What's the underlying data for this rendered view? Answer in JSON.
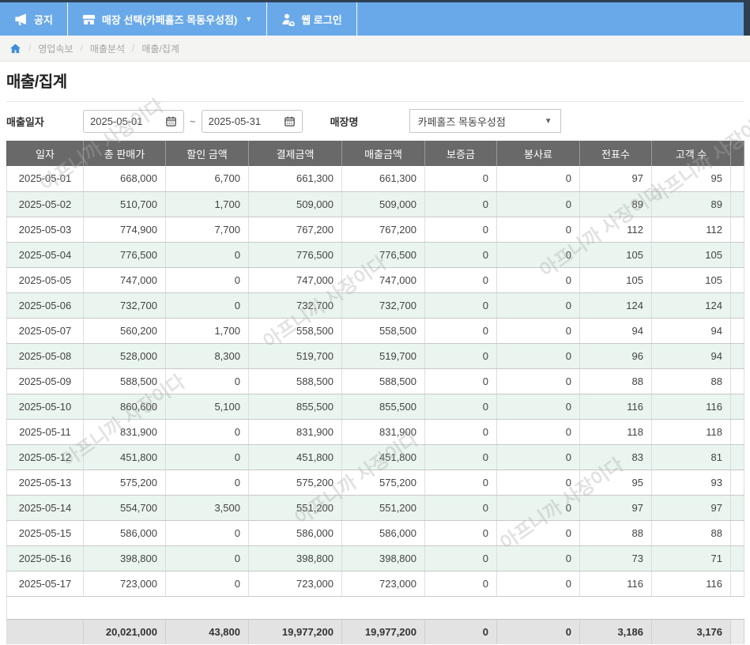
{
  "topbar": {
    "notice": "공지",
    "store_select": "매장 선택(카페홀즈 목동우성점)",
    "caret": "▼",
    "web_login": "웹 로그인"
  },
  "breadcrumb": {
    "separator": "/",
    "items": [
      "영업속보",
      "매출분석",
      "매출/집계"
    ]
  },
  "page": {
    "title": "매출/집계"
  },
  "filters": {
    "date_label": "매출일자",
    "date_from": "2025-05-01",
    "date_to": "2025-05-31",
    "range_separator": "~",
    "store_label": "매장명",
    "store_value": "카페홀즈 목동우성점",
    "select_caret": "▼"
  },
  "table": {
    "columns": [
      "일자",
      "총 판매가",
      "할인 금액",
      "결제금액",
      "매출금액",
      "보증금",
      "봉사료",
      "전표수",
      "고객 수"
    ],
    "rows": [
      [
        "2025-05-01",
        "668,000",
        "6,700",
        "661,300",
        "661,300",
        "0",
        "0",
        "97",
        "95"
      ],
      [
        "2025-05-02",
        "510,700",
        "1,700",
        "509,000",
        "509,000",
        "0",
        "0",
        "89",
        "89"
      ],
      [
        "2025-05-03",
        "774,900",
        "7,700",
        "767,200",
        "767,200",
        "0",
        "0",
        "112",
        "112"
      ],
      [
        "2025-05-04",
        "776,500",
        "0",
        "776,500",
        "776,500",
        "0",
        "0",
        "105",
        "105"
      ],
      [
        "2025-05-05",
        "747,000",
        "0",
        "747,000",
        "747,000",
        "0",
        "0",
        "105",
        "105"
      ],
      [
        "2025-05-06",
        "732,700",
        "0",
        "732,700",
        "732,700",
        "0",
        "0",
        "124",
        "124"
      ],
      [
        "2025-05-07",
        "560,200",
        "1,700",
        "558,500",
        "558,500",
        "0",
        "0",
        "94",
        "94"
      ],
      [
        "2025-05-08",
        "528,000",
        "8,300",
        "519,700",
        "519,700",
        "0",
        "0",
        "96",
        "94"
      ],
      [
        "2025-05-09",
        "588,500",
        "0",
        "588,500",
        "588,500",
        "0",
        "0",
        "88",
        "88"
      ],
      [
        "2025-05-10",
        "860,600",
        "5,100",
        "855,500",
        "855,500",
        "0",
        "0",
        "116",
        "116"
      ],
      [
        "2025-05-11",
        "831,900",
        "0",
        "831,900",
        "831,900",
        "0",
        "0",
        "118",
        "118"
      ],
      [
        "2025-05-12",
        "451,800",
        "0",
        "451,800",
        "451,800",
        "0",
        "0",
        "83",
        "81"
      ],
      [
        "2025-05-13",
        "575,200",
        "0",
        "575,200",
        "575,200",
        "0",
        "0",
        "95",
        "93"
      ],
      [
        "2025-05-14",
        "554,700",
        "3,500",
        "551,200",
        "551,200",
        "0",
        "0",
        "97",
        "97"
      ],
      [
        "2025-05-15",
        "586,000",
        "0",
        "586,000",
        "586,000",
        "0",
        "0",
        "88",
        "88"
      ],
      [
        "2025-05-16",
        "398,800",
        "0",
        "398,800",
        "398,800",
        "0",
        "0",
        "73",
        "71"
      ],
      [
        "2025-05-17",
        "723,000",
        "0",
        "723,000",
        "723,000",
        "0",
        "0",
        "116",
        "116"
      ]
    ],
    "totals": [
      "",
      "20,021,000",
      "43,800",
      "19,977,200",
      "19,977,200",
      "0",
      "0",
      "3,186",
      "3,176"
    ]
  },
  "watermark": {
    "text": "아프니까 사장이다"
  },
  "colors": {
    "topbar_blue": "#69a9e9",
    "topbar_edge_navy": "#2e3f52",
    "header_gray": "#696969",
    "alt_row_green": "#e9f5ee",
    "total_row_gray": "#e3e3e3",
    "breadcrumb_bg": "#f4f4f2",
    "home_icon_blue": "#3d8fd6"
  }
}
